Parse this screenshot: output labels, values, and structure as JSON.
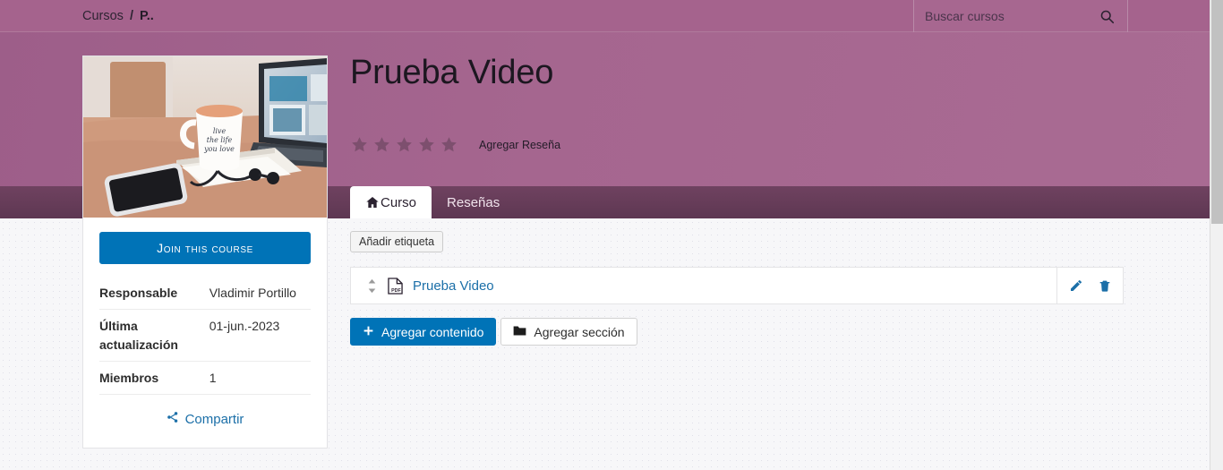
{
  "breadcrumb": {
    "items": [
      "Cursos",
      "P.."
    ],
    "separator": "/"
  },
  "search": {
    "placeholder": "Buscar cursos",
    "value": "",
    "icon": "search-icon"
  },
  "hero": {
    "title": "Prueba Video",
    "rating": {
      "value": 0,
      "max": 5,
      "star_icon": "star-icon"
    },
    "add_review_label": "Agregar Reseña"
  },
  "tabs": [
    {
      "label": "Curso",
      "active": true,
      "icon": "home-icon"
    },
    {
      "label": "Reseñas",
      "active": false,
      "icon": ""
    }
  ],
  "sidebar": {
    "thumbnail_alt": "desk-photo-laptop-mug-phone",
    "join_label": "Join this Course",
    "info": [
      {
        "key": "Responsable",
        "value": "Vladimir Portillo"
      },
      {
        "key": "Última actualización",
        "value": "01-jun.-2023"
      },
      {
        "key": "Miembros",
        "value": "1"
      }
    ],
    "share_label": "Compartir",
    "share_icon": "share-icon"
  },
  "main": {
    "add_tag_label": "Añadir etiqueta",
    "content_items": [
      {
        "title": "Prueba Video",
        "file_icon": "pdf-file-icon",
        "drag_icon": "drag-handle-icon",
        "edit_icon": "pencil-icon",
        "delete_icon": "trash-icon"
      }
    ],
    "buttons": [
      {
        "label": "Agregar contenido",
        "icon": "plus-icon",
        "style": "primary"
      },
      {
        "label": "Agregar sección",
        "icon": "folder-icon",
        "style": "default"
      }
    ]
  },
  "colors": {
    "header_purple": "#a5638d",
    "tab_band_purple": "#6f4260",
    "primary_blue": "#0073b7",
    "link_blue": "#1b6fa8",
    "page_background": "#f7f7f9"
  }
}
